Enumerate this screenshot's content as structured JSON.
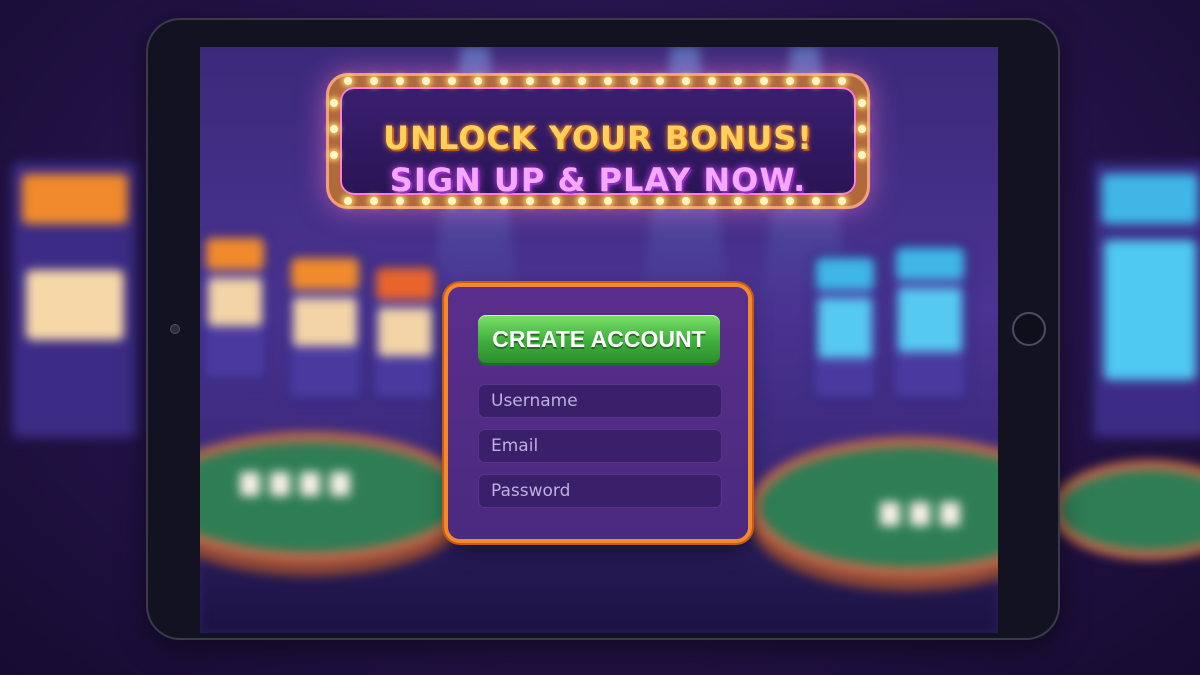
{
  "marquee": {
    "line1": "UNLOCK YOUR BONUS!",
    "line2": "SIGN UP & PLAY NOW."
  },
  "signup": {
    "create_account_label": "CREATE ACCOUNT",
    "username_placeholder": "Username",
    "email_placeholder": "Email",
    "password_placeholder": "Password"
  },
  "colors": {
    "button_green": "#3fae3c",
    "panel_border": "#f08a2c",
    "panel_bg": "#5a2e8c",
    "headline_gold": "#ffd15a",
    "headline_pink": "#f5a8ff"
  },
  "icons": [
    "home-button-icon",
    "camera-icon"
  ]
}
